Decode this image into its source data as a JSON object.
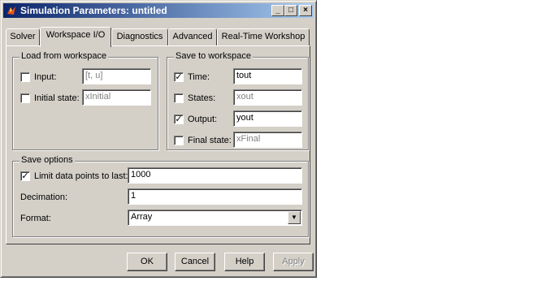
{
  "window": {
    "title": "Simulation Parameters: untitled",
    "controls": {
      "minimize": "_",
      "maximize": "□",
      "close": "×"
    }
  },
  "tabs": [
    {
      "label": "Solver"
    },
    {
      "label": "Workspace I/O",
      "active": true
    },
    {
      "label": "Diagnostics"
    },
    {
      "label": "Advanced"
    },
    {
      "label": "Real-Time Workshop"
    }
  ],
  "load": {
    "legend": "Load from workspace",
    "input": {
      "label": "Input:",
      "checked": false,
      "value": "[t, u]"
    },
    "initial_state": {
      "label": "Initial state:",
      "checked": false,
      "value": "xInitial"
    }
  },
  "save": {
    "legend": "Save to workspace",
    "time": {
      "label": "Time:",
      "checked": true,
      "value": "tout"
    },
    "states": {
      "label": "States:",
      "checked": false,
      "value": "xout"
    },
    "output": {
      "label": "Output:",
      "checked": true,
      "value": "yout"
    },
    "final_state": {
      "label": "Final state:",
      "checked": false,
      "value": "xFinal"
    }
  },
  "options": {
    "legend": "Save options",
    "limit": {
      "label": "Limit data points to last:",
      "checked": true,
      "value": "1000"
    },
    "decimation": {
      "label": "Decimation:",
      "value": "1"
    },
    "format": {
      "label": "Format:",
      "value": "Array"
    }
  },
  "buttons": {
    "ok": "OK",
    "cancel": "Cancel",
    "help": "Help",
    "apply": "Apply"
  },
  "check_mark": "✓",
  "dropdown_arrow": "▼"
}
